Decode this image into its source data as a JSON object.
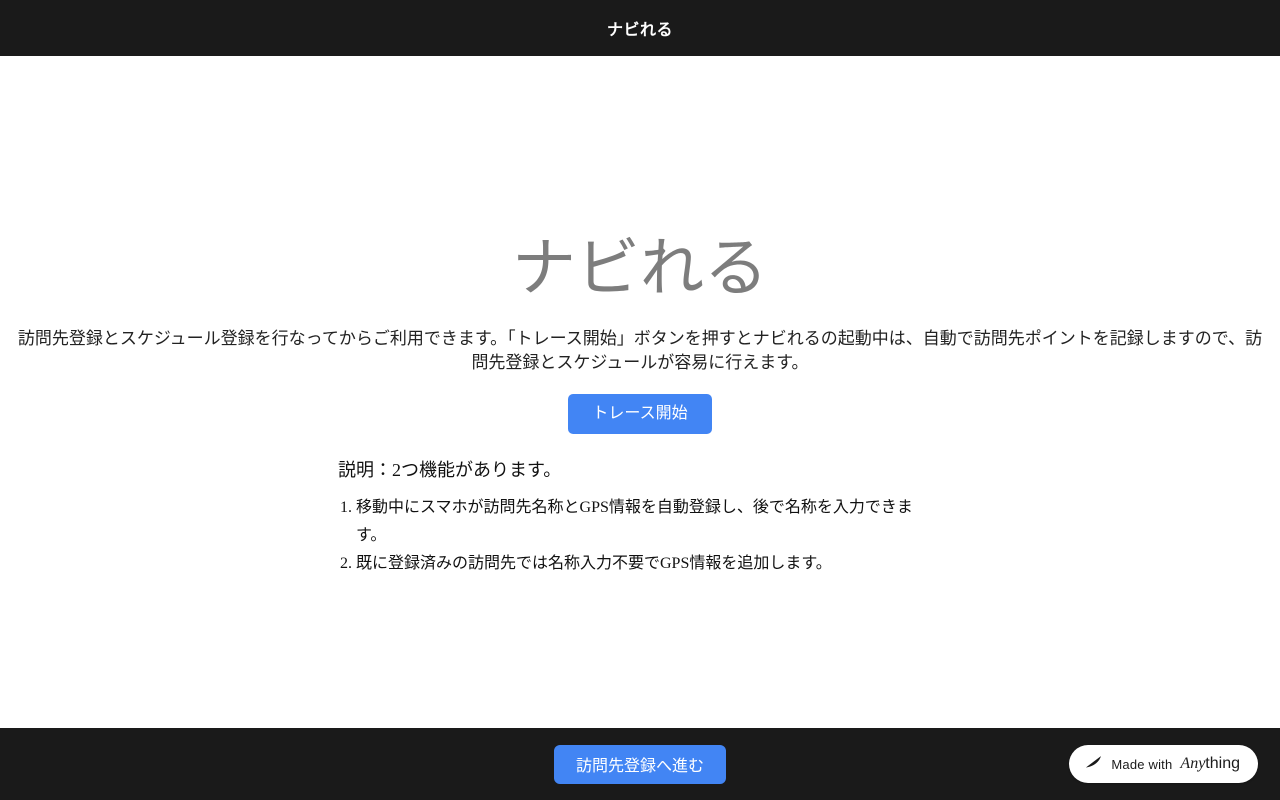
{
  "header": {
    "title": "ナビれる"
  },
  "hero": {
    "title": "ナビれる",
    "description": "訪問先登録とスケジュール登録を行なってからご利用できます。「トレース開始」ボタンを押すとナビれるの起動中は、自動で訪問先ポイントを記録しますので、訪問先登録とスケジュールが容易に行えます。",
    "trace_button_label": "トレース開始"
  },
  "explanation": {
    "heading": "説明：2つ機能があります。",
    "items": [
      "移動中にスマホが訪問先名称とGPS情報を自動登録し、後で名称を入力できます。",
      "既に登録済みの訪問先では名称入力不要でGPS情報を追加します。"
    ]
  },
  "footer": {
    "proceed_button_label": "訪問先登録へ進む",
    "badge": {
      "prefix": "Made with",
      "brand_italic": "Any",
      "brand_rest": "thing"
    }
  },
  "colors": {
    "accent_blue": "#4285f4",
    "bar_dark": "#1a1a1a",
    "title_gray": "#7d7d7d"
  }
}
